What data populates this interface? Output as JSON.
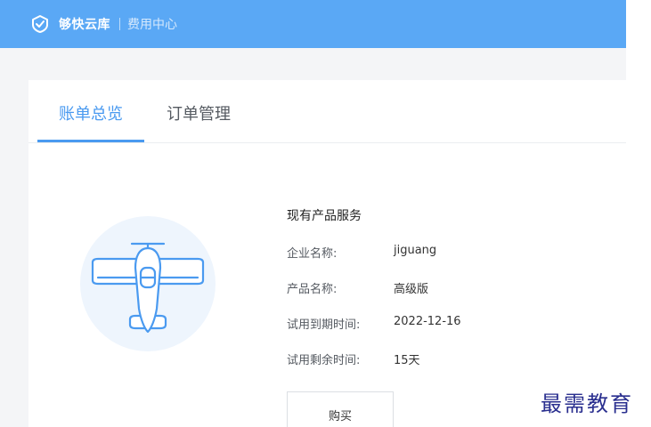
{
  "header": {
    "brand": "够快云库",
    "subtitle": "费用中心",
    "logo_icon": "shield-check-icon",
    "bg_color": "#5aa8f5"
  },
  "tabs": [
    {
      "label": "账单总览",
      "active": true
    },
    {
      "label": "订单管理",
      "active": false
    }
  ],
  "product": {
    "section_title": "现有产品服务",
    "rows": [
      {
        "label": "企业名称:",
        "value": "jiguang"
      },
      {
        "label": "产品名称:",
        "value": "高级版"
      },
      {
        "label": "试用到期时间:",
        "value": "2022-12-16"
      },
      {
        "label": "试用剩余时间:",
        "value": "15天"
      }
    ],
    "buy_label": "购买",
    "illustration_icon": "airplane-icon"
  },
  "watermark": "最需教育",
  "accent_color": "#4a9af0"
}
